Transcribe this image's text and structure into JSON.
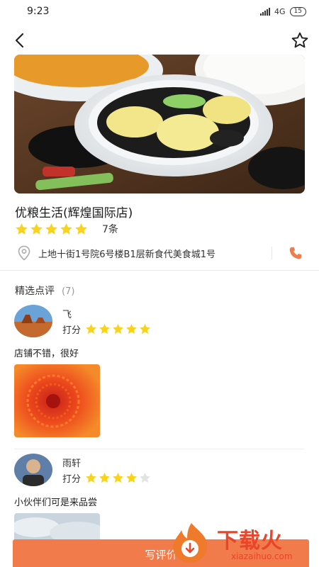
{
  "status_bar": {
    "time": "9:23",
    "network": "4G",
    "battery": "15"
  },
  "icons": {
    "back": "chevron-left-icon",
    "favorite": "star-outline-icon",
    "location": "map-pin-icon",
    "phone": "phone-icon",
    "rating_star": "star-filled-icon"
  },
  "colors": {
    "accent": "#f27b4b",
    "star_active": "#f9d21b",
    "star_inactive": "#e3e3e3",
    "phone": "#f27b4b"
  },
  "shop": {
    "name": "优粮生活(辉煌国际店)",
    "rating": 5,
    "review_count": "7条",
    "address": "上地十街1号院6号楼B1层新食代美食城1号"
  },
  "reviews_section": {
    "title": "精选点评",
    "count": "(7)"
  },
  "reviews": [
    {
      "name": "飞",
      "score_label": "打分",
      "rating": 5,
      "text": "店铺不错，很好",
      "photo": "orange-flower"
    },
    {
      "name": "雨轩",
      "score_label": "打分",
      "rating": 4,
      "text": "小伙伴们可是来品尝",
      "photo": "sky"
    }
  ],
  "actions": {
    "write_review": "写评价"
  },
  "watermark": {
    "brand": "下载火",
    "domain": "xiazaihuo.com"
  }
}
